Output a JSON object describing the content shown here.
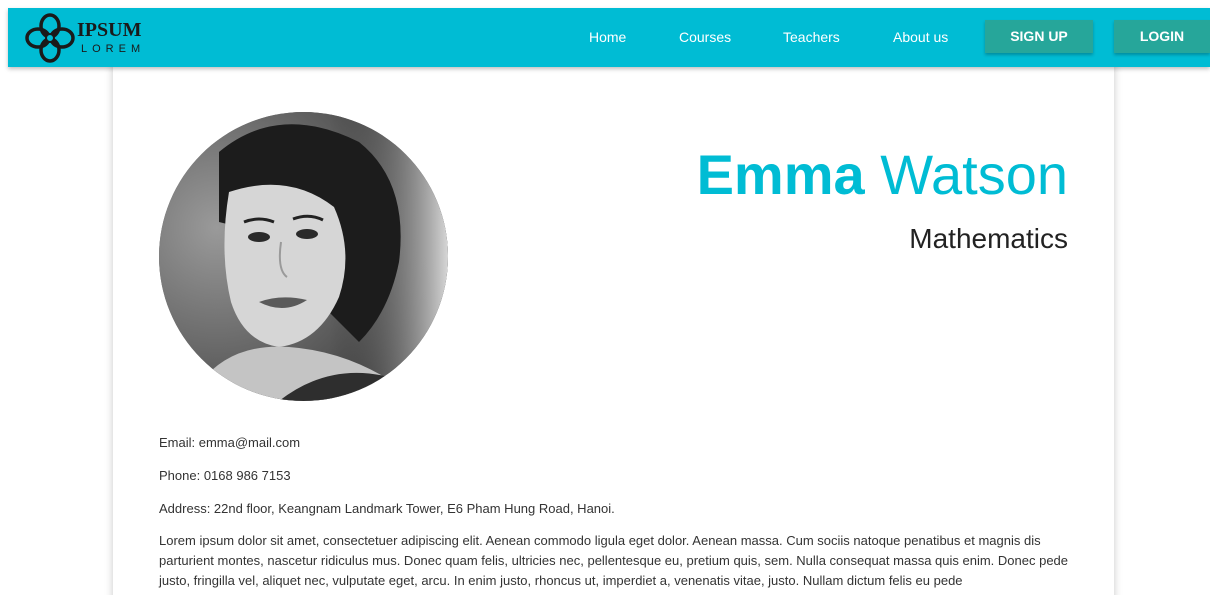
{
  "brand": {
    "name_top": "IPSUM",
    "name_bottom": "LOREM"
  },
  "nav": {
    "links": [
      {
        "label": "Home"
      },
      {
        "label": "Courses"
      },
      {
        "label": "Teachers"
      },
      {
        "label": "About us"
      }
    ],
    "signup_label": "SIGN UP",
    "login_label": "LOGIN"
  },
  "profile": {
    "first_name": "Emma",
    "last_name": "Watson",
    "subject": "Mathematics",
    "email": "Email: emma@mail.com",
    "phone": "Phone: 0168 986 7153",
    "address": "Address: 22nd floor, Keangnam Landmark Tower, E6 Pham Hung Road, Hanoi.",
    "bio": "Lorem ipsum dolor sit amet, consectetuer adipiscing elit. Aenean commodo ligula eget dolor. Aenean massa. Cum sociis natoque penatibus et magnis dis parturient montes, nascetur ridiculus mus. Donec quam felis, ultricies nec, pellentesque eu, pretium quis, sem. Nulla consequat massa quis enim. Donec pede justo, fringilla vel, aliquet nec, vulputate eget, arcu. In enim justo, rhoncus ut, imperdiet a, venenatis vitae, justo. Nullam dictum felis eu pede"
  },
  "colors": {
    "primary": "#00bcd4",
    "button": "#26a69a",
    "text": "#333333"
  },
  "icons": {
    "logo": "flower-logo-icon"
  }
}
